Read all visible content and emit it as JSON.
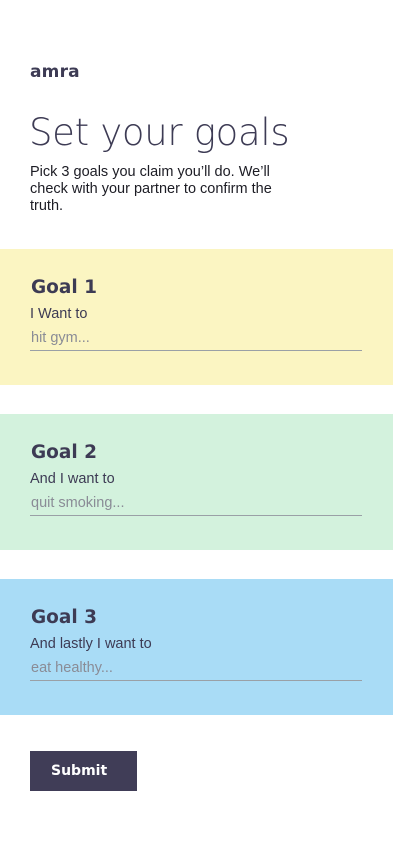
{
  "app": {
    "brand": "amra"
  },
  "header": {
    "title": "Set your goals",
    "intro": "Pick 3 goals you claim you’ll do. We’ll check with your partner to confirm the truth."
  },
  "goals": [
    {
      "heading": "Goal 1",
      "label": "I Want to",
      "placeholder": "hit gym...",
      "value": "",
      "color": "#fbf5c2"
    },
    {
      "heading": "Goal 2",
      "label": "And I want to",
      "placeholder": "quit smoking...",
      "value": "",
      "color": "#d3f2dd"
    },
    {
      "heading": "Goal 3",
      "label": "And lastly I want to",
      "placeholder": "eat healthy...",
      "value": "",
      "color": "#a9dcf6"
    }
  ],
  "actions": {
    "submit_label": "Submit"
  },
  "colors": {
    "text": "#3d3b54",
    "button": "#403d57",
    "input_line": "#9aa0a6"
  }
}
